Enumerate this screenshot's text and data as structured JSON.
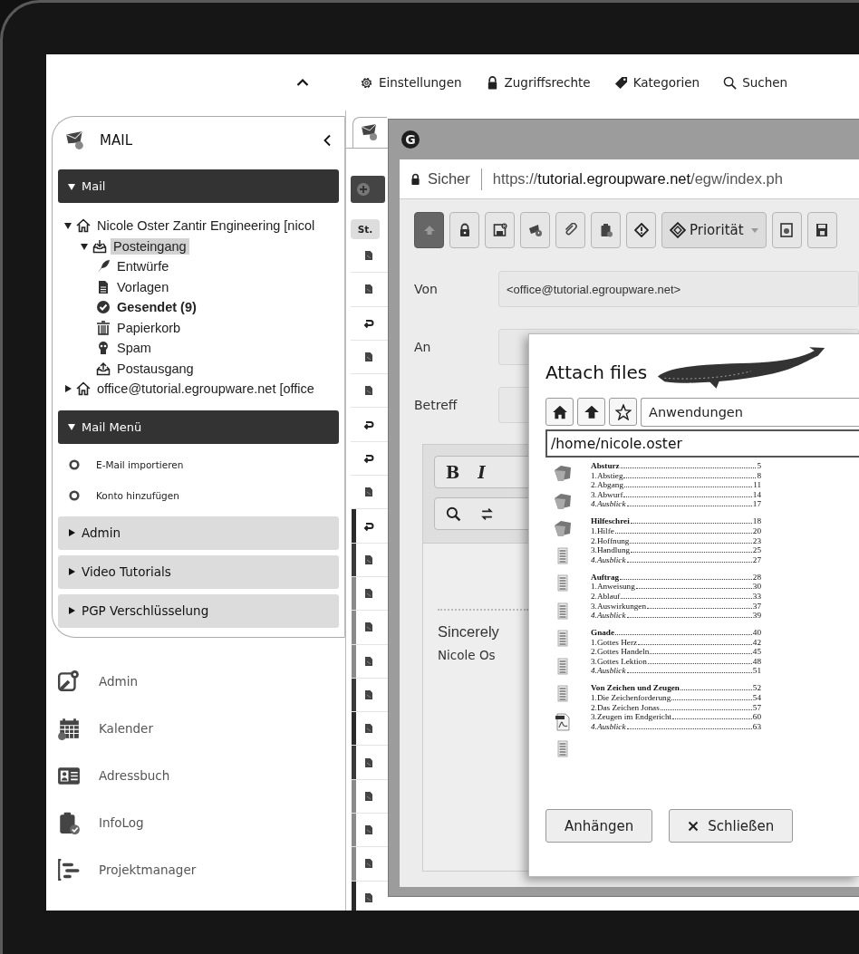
{
  "top_bar": {
    "actions": [
      {
        "kind": "settings",
        "label": "Einstellungen"
      },
      {
        "kind": "permissions",
        "label": "Zugriffsrechte"
      },
      {
        "kind": "categories",
        "label": "Kategorien"
      },
      {
        "kind": "search",
        "label": "Suchen"
      }
    ]
  },
  "sidebar": {
    "title": "MAIL",
    "mail_section": {
      "label": "Mail",
      "expanded": true
    },
    "folders": [
      {
        "kind": "account",
        "label": "Nicole Oster Zantir Engineering [nicol",
        "expanded": true,
        "selected": false,
        "unread": false,
        "children": [
          {
            "kind": "inbox",
            "label": "Posteingang",
            "expanded": true,
            "selected": true,
            "unread": false,
            "children": [
              {
                "kind": "drafts",
                "label": "Entwürfe",
                "selected": false,
                "unread": false
              },
              {
                "kind": "templates",
                "label": "Vorlagen",
                "selected": false,
                "unread": false
              },
              {
                "kind": "sent",
                "label": "Gesendet (9)",
                "selected": false,
                "unread": true
              },
              {
                "kind": "trash",
                "label": "Papierkorb",
                "selected": false,
                "unread": false
              },
              {
                "kind": "spam",
                "label": "Spam",
                "selected": false,
                "unread": false
              },
              {
                "kind": "outbox",
                "label": "Postausgang",
                "selected": false,
                "unread": false
              }
            ]
          }
        ]
      },
      {
        "kind": "account",
        "label": "office@tutorial.egroupware.net [office",
        "expanded": false,
        "selected": false,
        "unread": false
      }
    ],
    "menu_section": {
      "label": "Mail Menü",
      "expanded": true
    },
    "menu_items": [
      {
        "label": "E-Mail importieren"
      },
      {
        "label": "Konto hinzufügen"
      }
    ],
    "sections": [
      {
        "label": "Admin",
        "expanded": false
      },
      {
        "label": "Video Tutorials",
        "expanded": false
      },
      {
        "label": "PGP Verschlüsselung",
        "expanded": false
      }
    ],
    "apps": [
      {
        "kind": "admin",
        "label": "Admin"
      },
      {
        "kind": "calendar",
        "label": "Kalender"
      },
      {
        "kind": "addressbook",
        "label": "Adressbuch"
      },
      {
        "kind": "infolog",
        "label": "InfoLog"
      },
      {
        "kind": "projects",
        "label": "Projektmanager"
      }
    ]
  },
  "mail_list": {
    "status_header": "St.",
    "rows": [
      {
        "kind": "message"
      },
      {
        "kind": "message"
      },
      {
        "kind": "reply"
      },
      {
        "kind": "message"
      },
      {
        "kind": "message"
      },
      {
        "kind": "reply"
      },
      {
        "kind": "reply"
      },
      {
        "kind": "message"
      },
      {
        "kind": "reply",
        "color": "#2a2a2a"
      },
      {
        "kind": "message",
        "color": "#3a3a3a"
      },
      {
        "kind": "message",
        "color": "#8a8a8a"
      },
      {
        "kind": "message",
        "color": "#8a8a8a"
      },
      {
        "kind": "message",
        "color": "#8a8a8a"
      },
      {
        "kind": "message",
        "color": "#3a3a3a"
      },
      {
        "kind": "message",
        "color": "#2a2a2a"
      },
      {
        "kind": "message",
        "color": "#3a3a3a"
      },
      {
        "kind": "message",
        "color": "#8a8a8a"
      },
      {
        "kind": "message",
        "color": "#8a8a8a"
      },
      {
        "kind": "message",
        "color": "#8a8a8a"
      },
      {
        "kind": "message",
        "color": "#2a2a2a"
      }
    ]
  },
  "compose": {
    "logo": "G",
    "security": "Sicher",
    "url": {
      "scheme": "https://",
      "host": "tutorial.egroupware.net",
      "path": "/egw/index.ph"
    },
    "priority": "Priorität",
    "fields": [
      {
        "label": "Von",
        "value": "<office@tutorial.egroupware.net>"
      },
      {
        "label": "An"
      },
      {
        "label": "Betreff"
      }
    ],
    "format_buttons": [
      "B",
      "I"
    ],
    "signature": [
      "Sincerely",
      "Nicole Os"
    ]
  },
  "attach": {
    "title": "Attach files",
    "location": "Anwendungen",
    "path": "/home/nicole.oster",
    "files": [
      {
        "kind": "folder"
      },
      {
        "kind": "folder"
      },
      {
        "kind": "folder"
      },
      {
        "kind": "document"
      },
      {
        "kind": "document"
      },
      {
        "kind": "document"
      },
      {
        "kind": "document"
      },
      {
        "kind": "document"
      },
      {
        "kind": "document"
      },
      {
        "kind": "pdf"
      },
      {
        "kind": "document"
      }
    ],
    "toc": [
      {
        "title": "Absturz",
        "page": "5",
        "entries": [
          {
            "label": "1.Abstieg",
            "page": "8",
            "italic": false
          },
          {
            "label": "2.Abgang",
            "page": "11",
            "italic": false
          },
          {
            "label": "3.Abwurf",
            "page": "14",
            "italic": false
          },
          {
            "label": "4.Ausblick",
            "page": "17",
            "italic": true
          }
        ]
      },
      {
        "title": "Hilfeschrei",
        "page": "18",
        "entries": [
          {
            "label": "1.Hilfe",
            "page": "20",
            "italic": false
          },
          {
            "label": "2.Hoffnung",
            "page": "23",
            "italic": false
          },
          {
            "label": "3.Handlung",
            "page": "25",
            "italic": false
          },
          {
            "label": "4.Ausblick",
            "page": "27",
            "italic": true
          }
        ]
      },
      {
        "title": "Auftrag",
        "page": "28",
        "entries": [
          {
            "label": "1.Anweisung",
            "page": "30",
            "italic": false
          },
          {
            "label": "2.Ablauf",
            "page": "33",
            "italic": false
          },
          {
            "label": "3.Auswirkungen",
            "page": "37",
            "italic": false
          },
          {
            "label": "4.Ausblick",
            "page": "39",
            "italic": true
          }
        ]
      },
      {
        "title": "Gnade",
        "page": "40",
        "entries": [
          {
            "label": "1.Gottes Herz",
            "page": "42",
            "italic": false
          },
          {
            "label": "2.Gottes Handeln",
            "page": "45",
            "italic": false
          },
          {
            "label": "3.Gottes Lektion",
            "page": "48",
            "italic": false
          },
          {
            "label": "4.Ausblick",
            "page": "51",
            "italic": true
          }
        ]
      },
      {
        "title": "Von Zeichen und Zeugen",
        "page": "52",
        "entries": [
          {
            "label": "1.Die Zeichenforderung",
            "page": "54",
            "italic": false
          },
          {
            "label": "2.Das Zeichen Jonas",
            "page": "57",
            "italic": false
          },
          {
            "label": "3.Zeugen im Endgericht",
            "page": "60",
            "italic": false
          },
          {
            "label": "4.Ausblick",
            "page": "63",
            "italic": true
          }
        ]
      }
    ],
    "buttons": [
      {
        "kind": "attach",
        "label": "Anhängen"
      },
      {
        "kind": "close",
        "label": "Schließen"
      }
    ]
  }
}
